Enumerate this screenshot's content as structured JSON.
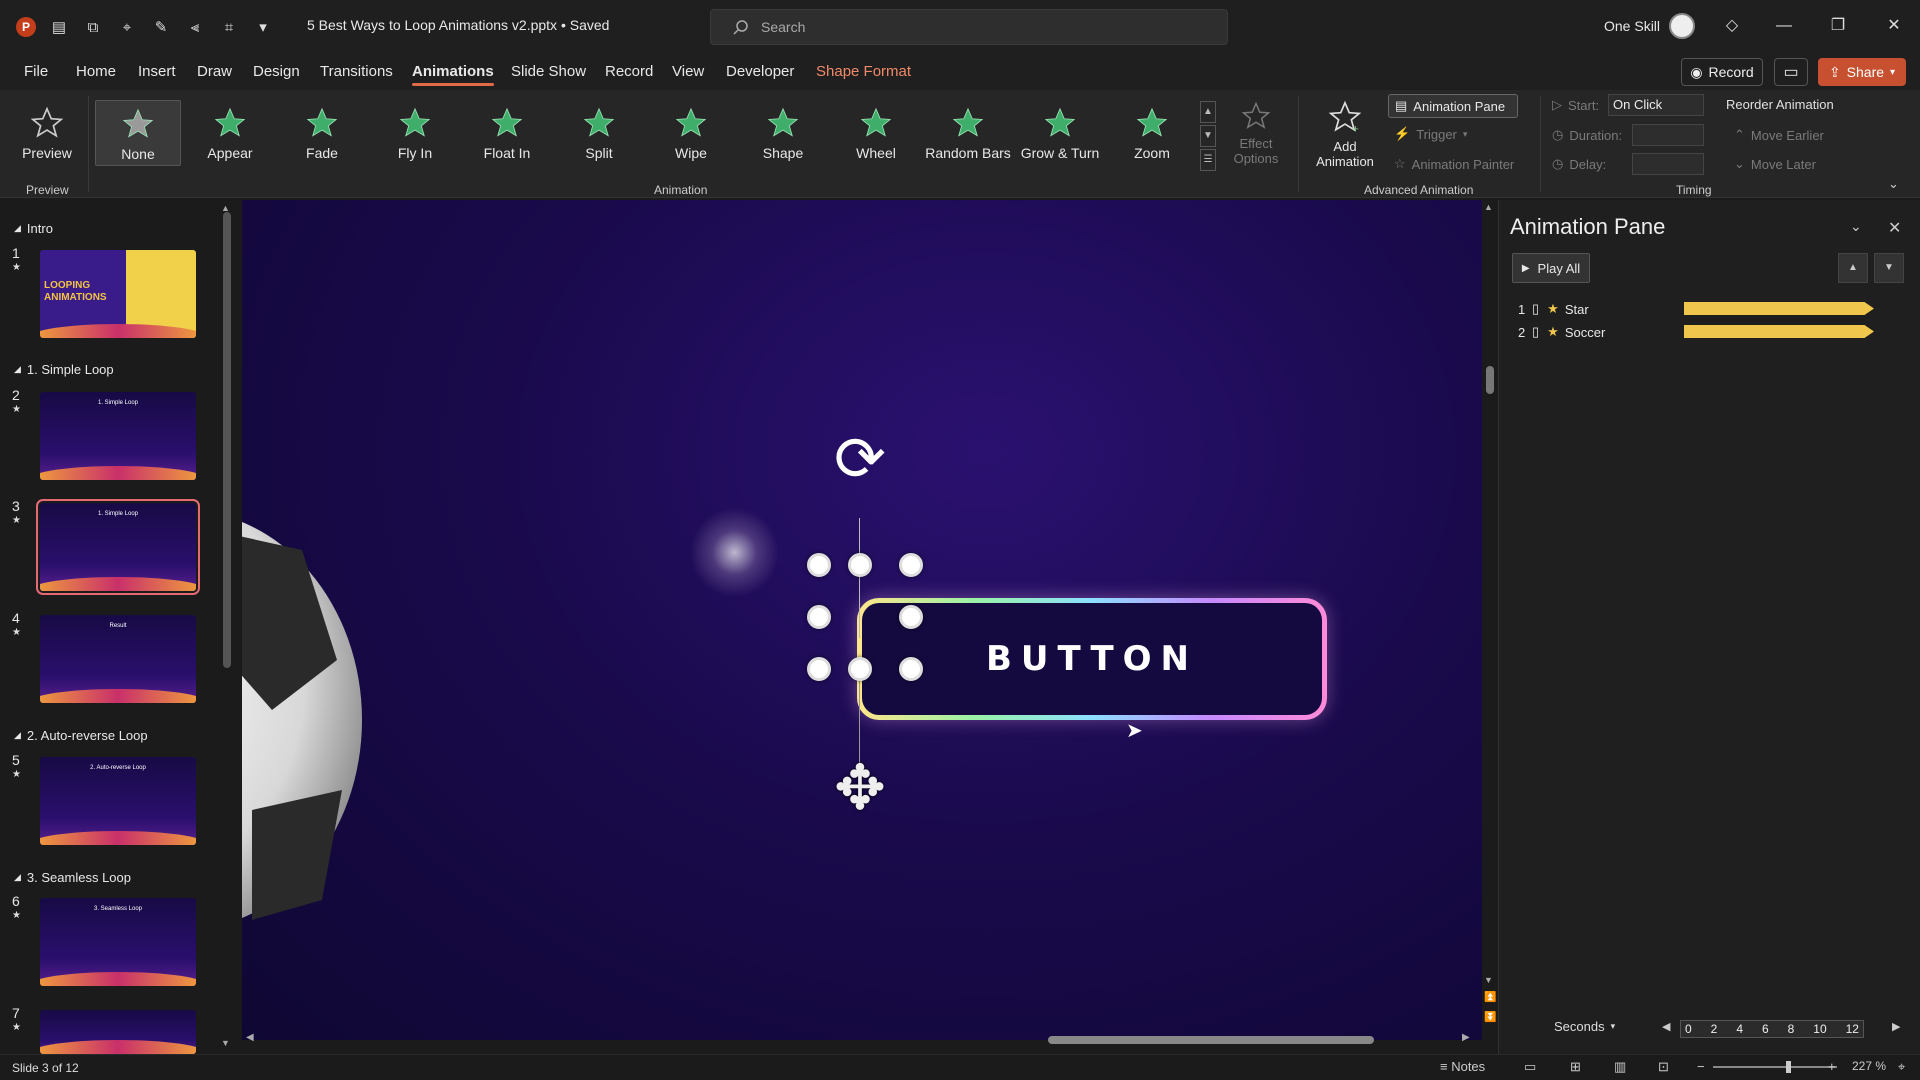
{
  "titlebar": {
    "doc_title": "5 Best Ways to Loop Animations v2.pptx • Saved",
    "search_placeholder": "Search",
    "user_name": "One Skill"
  },
  "menu": [
    "File",
    "Home",
    "Insert",
    "Draw",
    "Design",
    "Transitions",
    "Animations",
    "Slide Show",
    "Record",
    "View",
    "Developer",
    "Shape Format"
  ],
  "menu_active": "Animations",
  "actions": {
    "record": "Record",
    "share": "Share"
  },
  "ribbon": {
    "preview": {
      "label": "Preview",
      "group": "Preview"
    },
    "animation_group": "Animation",
    "animations": [
      "None",
      "Appear",
      "Fade",
      "Fly In",
      "Float In",
      "Split",
      "Wipe",
      "Shape",
      "Wheel",
      "Random Bars",
      "Grow & Turn",
      "Zoom"
    ],
    "effect_options": "Effect Options",
    "add_animation": "Add Animation",
    "animation_pane": "Animation Pane",
    "trigger": "Trigger",
    "animation_painter": "Animation Painter",
    "advanced_group": "Advanced Animation",
    "start_label": "Start:",
    "start_value": "On Click",
    "duration_label": "Duration:",
    "delay_label": "Delay:",
    "timing_group": "Timing",
    "reorder": "Reorder Animation",
    "move_earlier": "Move Earlier",
    "move_later": "Move Later"
  },
  "slides_panel": {
    "sections": [
      "Intro",
      "1. Simple Loop",
      "2. Auto-reverse Loop",
      "3. Seamless Loop"
    ],
    "slides": [
      {
        "num": "1",
        "title": "LOOPING ANIMATIONS"
      },
      {
        "num": "2",
        "title": "1. Simple Loop"
      },
      {
        "num": "3",
        "title": "1. Simple Loop"
      },
      {
        "num": "4",
        "title": "Result"
      },
      {
        "num": "5",
        "title": "2. Auto-reverse Loop"
      },
      {
        "num": "6",
        "title": "3. Seamless Loop"
      },
      {
        "num": "7",
        "title": ""
      }
    ],
    "selected": "3"
  },
  "canvas": {
    "button_text": "BUTTON"
  },
  "animation_pane": {
    "title": "Animation Pane",
    "play_all": "Play All",
    "items": [
      {
        "num": "1",
        "name": "Star"
      },
      {
        "num": "2",
        "name": "Soccer"
      }
    ],
    "timeline_unit": "Seconds",
    "ticks": [
      "0",
      "2",
      "4",
      "6",
      "8",
      "10",
      "12"
    ]
  },
  "status": {
    "slide": "Slide 3 of 12",
    "notes": "Notes",
    "zoom": "227 %"
  },
  "colors": {
    "accent": "#e06a48",
    "share": "#c6502f",
    "bar": "#f0c64c"
  }
}
